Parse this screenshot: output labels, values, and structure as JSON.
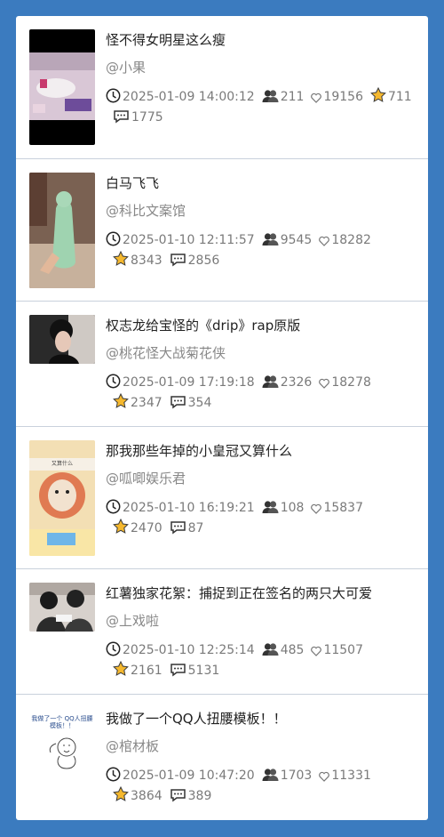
{
  "items": [
    {
      "title": "怪不得女明星这么瘦",
      "author": "@小果",
      "time": "2025-01-09 14:00:12",
      "viewers": "211",
      "likes": "19156",
      "stars": "711",
      "comments": "1775"
    },
    {
      "title": "白马飞飞",
      "author": "@科比文案馆",
      "time": "2025-01-10 12:11:57",
      "viewers": "9545",
      "likes": "18282",
      "stars": "8343",
      "comments": "2856"
    },
    {
      "title": "权志龙给宝怪的《drip》rap原版",
      "author": "@桃花怪大战菊花侠",
      "time": "2025-01-09 17:19:18",
      "viewers": "2326",
      "likes": "18278",
      "stars": "2347",
      "comments": "354"
    },
    {
      "title": "那我那些年掉的小皇冠又算什么",
      "author": "@呱唧娱乐君",
      "time": "2025-01-10 16:19:21",
      "viewers": "108",
      "likes": "15837",
      "stars": "2470",
      "comments": "87",
      "thumb_text": "又算什么"
    },
    {
      "title": "红薯独家花絮：捕捉到正在签名的两只大可爱",
      "author": "@上戏啦",
      "time": "2025-01-10 12:25:14",
      "viewers": "485",
      "likes": "11507",
      "stars": "2161",
      "comments": "5131"
    },
    {
      "title": "我做了一个QQ人扭腰模板！！",
      "author": "@棺材板",
      "time": "2025-01-09 10:47:20",
      "viewers": "1703",
      "likes": "11331",
      "stars": "3864",
      "comments": "389",
      "thumb_text": "我做了一个 QQ人扭腰模板！！"
    }
  ],
  "colors": {
    "background": "#3b7bbf",
    "card": "#ffffff",
    "star": "#f5b82e"
  },
  "icons": {
    "time": "clock-icon",
    "viewers": "viewers-icon",
    "likes": "heart-icon",
    "stars": "star-icon",
    "comments": "comment-icon"
  }
}
